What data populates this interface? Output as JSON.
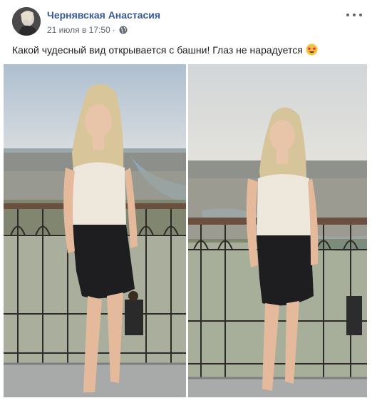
{
  "post": {
    "author": "Чернявская Анастасия",
    "date": "21 июля в 17:50",
    "separator": "·",
    "privacy_icon": "globe-icon",
    "more_icon": "more-dots-icon",
    "text": "Какой чудесный вид открывается с башни! Глаз не нарадуется",
    "emoji_icon": "star-struck-emoji-icon"
  },
  "photos": [
    {
      "name": "photo-left",
      "subject": "woman-on-eiffel-tower-photo"
    },
    {
      "name": "photo-right",
      "subject": "woman-on-eiffel-tower-photo"
    }
  ],
  "colors": {
    "author": "#385898",
    "meta": "#606770",
    "text": "#1c1e21",
    "sky": "#b9cad8",
    "river": "#8fa7b2"
  }
}
